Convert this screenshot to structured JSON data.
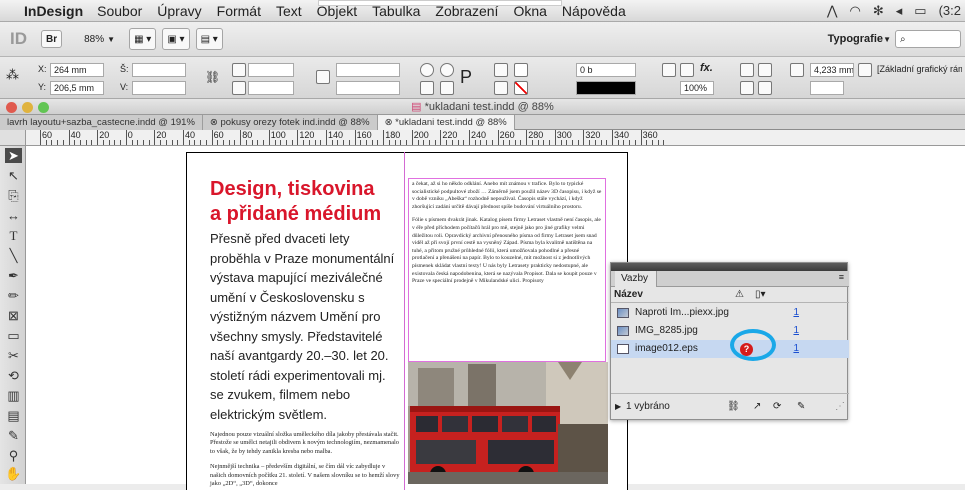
{
  "menubar": {
    "app": "InDesign",
    "items": [
      "Soubor",
      "Úpravy",
      "Formát",
      "Text",
      "Objekt",
      "Tabulka",
      "Zobrazení",
      "Okna",
      "Nápověda"
    ],
    "clock": "(3:2"
  },
  "control": {
    "zoom": "88%",
    "br": "Br",
    "workspace": "Typografie",
    "x": "264 mm",
    "y": "206,5 mm",
    "w_label": "Š:",
    "v_label": "V:",
    "x_label": "X:",
    "y_label": "Y:",
    "stroke": "0 b",
    "opacity": "100%",
    "offset": "4,233 mm",
    "style": "[Základní grafický ráme..."
  },
  "window": {
    "title": "*ukladani test.indd @ 88%"
  },
  "tabs": [
    {
      "label": "lavrh layoutu+sazba_castecne.indd @ 191%",
      "active": false
    },
    {
      "label": "pokusy orezy fotek ind.indd @ 88%",
      "active": false
    },
    {
      "label": "*ukladani test.indd @ 88%",
      "active": true
    }
  ],
  "ruler": [
    "60",
    "40",
    "20",
    "0",
    "20",
    "40",
    "60",
    "80",
    "100",
    "120",
    "140",
    "160",
    "180",
    "200",
    "220",
    "240",
    "260",
    "280",
    "300",
    "320",
    "340",
    "360"
  ],
  "article": {
    "headline1": "Design, tiskovina",
    "headline2": "a přidané médium",
    "lead": "Přesně před dvaceti lety proběhla v Praze monumentální výstava mapující meziválečné umění v Československu s výstižným názvem Umění pro všechny smysly. Představitelé naší avantgardy 20.–30. let 20. století rádi experimentovali mj. se zvukem, filmem nebo elektrickým světlem.",
    "body1": "Najednou pouze vizuální složka uměleckého díla jakoby přestávala stačit. Přestože se umělci netajili obdivem k novým technologiím, nezmamenalo to však, že by tehdy zanikla kresba nebo malba.",
    "body2": "Nejnmější technika – především digitální, se čím dál víc zabydluje v našich domovních počítku 21. století. V našem slovníku se to hemží slovy jako „2D“, „3D“, dokonce",
    "col2_p1": "a čekat, až si ho někdo odklání. Anebo mít známou v trafice. Bylo to typické socialistické podpultové zboží … Záměrně jsem použil název 3D časopisu, i když se v době vzniku „Abeška“ rozhodně nepoužíval. Časopis stále vychází, i když zhoršující zadání určitě dávají přednost spíše budování virtuálního prostoru.",
    "col2_p2": "Fólie s písmem dvakrát jinak. Katalog písem firmy Letraset vlastně není časopis, ale v éře před příchodem počítačů hrál pro mě, stejně jako pro jiné grafiky velmi důležitou roli. Opravdický archivní přenosného písma od firmy Letraset jsem snad viděl až při svojí první cestě na vysněný Západ. Písma byla kvalitně natištěna na tuhé, a přitom pružné průhledné fólii, která umožňovala pohodlné a přesné protlačení a přenášení na papír. Bylo to kouzelné, mít možnost si z jednotlivých písmenek skládat vlastní texty! U nás byly Letrasety prakticky nedostupné, ale existovala česká napodobenina, která se nazývala Propisot. Dala se koupit pouze v Praze ve speciální prodejně v Mikulandské ulici. Propisoty"
  },
  "links_panel": {
    "tab": "Vazby",
    "column": "Název",
    "rows": [
      {
        "name": "Naproti Im...piexx.jpg",
        "page": "1",
        "selected": false,
        "missing": false
      },
      {
        "name": "IMG_8285.jpg",
        "page": "1",
        "selected": false,
        "missing": false
      },
      {
        "name": "image012.eps",
        "page": "1",
        "selected": true,
        "missing": true
      }
    ],
    "status": "1 vybráno"
  },
  "colors": {
    "headline": "#d9162b",
    "highlight": "#1aa8e8",
    "missing": "#d51c1c"
  }
}
